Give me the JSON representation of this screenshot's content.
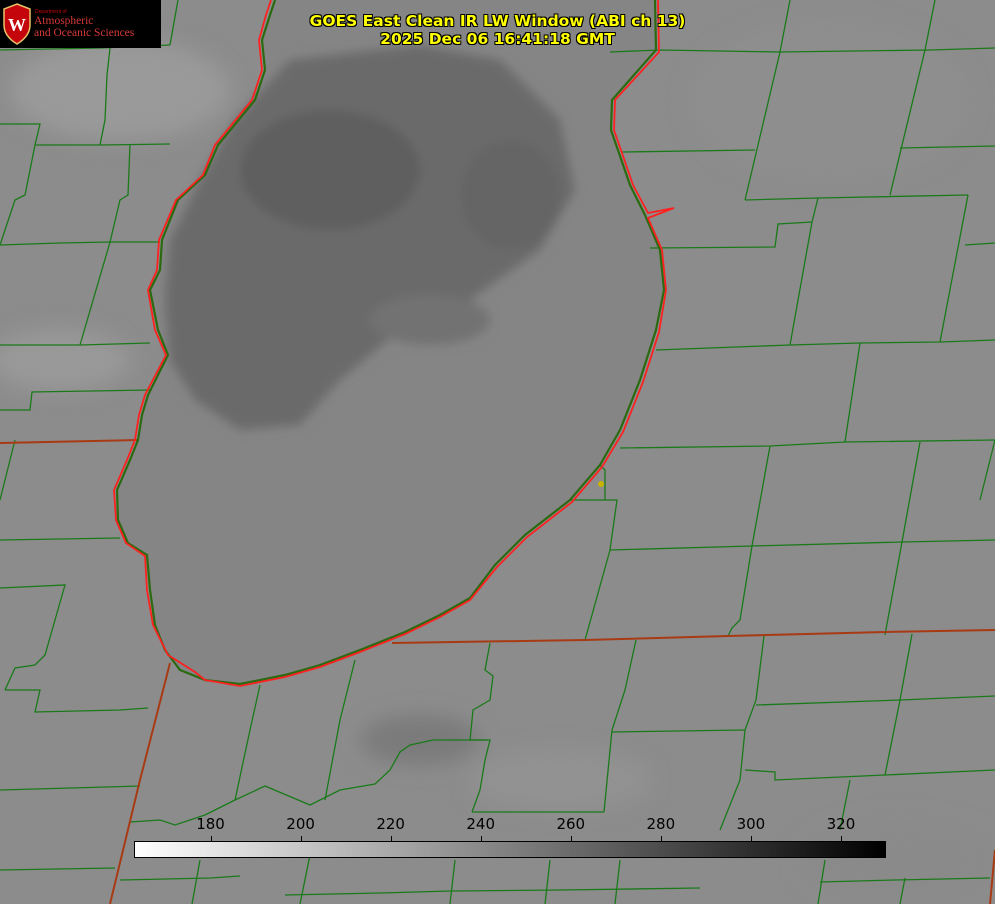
{
  "logo": {
    "department": "Department of",
    "line1": "Atmospheric",
    "line2": "and Oceanic Sciences",
    "seal_letter": "W"
  },
  "title": {
    "line1": "GOES East Clean IR LW Window (ABI ch 13)",
    "line2": "2025 Dec 06 16:41:18 GMT"
  },
  "colorbar": {
    "min": 163,
    "max": 330,
    "ticks": [
      "180",
      "200",
      "220",
      "240",
      "260",
      "280",
      "300",
      "320"
    ],
    "gradient": [
      "#ffffff",
      "#000000"
    ]
  },
  "colors": {
    "background": "#8b8b8b",
    "county_lines": "#1a7a1a",
    "state_lines": "#a83a14",
    "lake_shoreline": "#ff2020",
    "title_text": "#ffff00",
    "station_marker": "#c8b400"
  }
}
